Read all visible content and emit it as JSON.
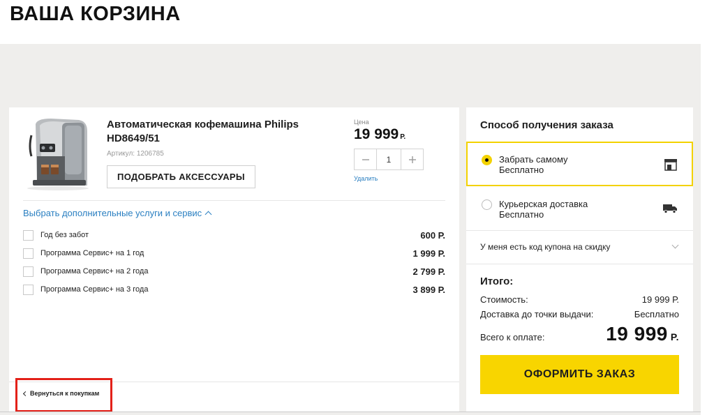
{
  "page": {
    "title": "ВАША КОРЗИНА"
  },
  "product": {
    "title": "Автоматическая кофемашина Philips HD8649/51",
    "article_label": "Артикул:",
    "article": "1206785",
    "accessories_label": "ПОДОБРАТЬ АКСЕССУАРЫ",
    "price_label": "Цена",
    "price": "19 999",
    "currency": "Р.",
    "quantity": "1",
    "remove_label": "Удалить"
  },
  "services": {
    "toggle_label": "Выбрать дополнительные услуги и сервис",
    "items": [
      {
        "name": "Год без забот",
        "price": "600 Р."
      },
      {
        "name": "Программа Сервис+ на 1 год",
        "price": "1 999 Р."
      },
      {
        "name": "Программа Сервис+ на 2 года",
        "price": "2 799 Р."
      },
      {
        "name": "Программа Сервис+ на 3 года",
        "price": "3 899 Р."
      }
    ]
  },
  "back_label": "Вернуться к покупкам",
  "delivery": {
    "title": "Способ получения заказа",
    "options": [
      {
        "name": "Забрать самому",
        "price": "Бесплатно",
        "selected": true,
        "icon": "store-icon"
      },
      {
        "name": "Курьерская доставка",
        "price": "Бесплатно",
        "selected": false,
        "icon": "truck-icon"
      }
    ],
    "coupon_label": "У меня есть код купона на скидку"
  },
  "summary": {
    "title": "Итого:",
    "cost_label": "Стоимость:",
    "cost_value": "19 999 Р.",
    "delivery_label": "Доставка до точки выдачи:",
    "delivery_value": "Бесплатно",
    "total_label": "Всего к оплате:",
    "total_value": "19 999",
    "total_currency": "Р."
  },
  "checkout_label": "ОФОРМИТЬ ЗАКАЗ",
  "colors": {
    "accent": "#f8d500",
    "link": "#2a7fc1",
    "highlight": "#e32119",
    "background": "#efeeec"
  }
}
